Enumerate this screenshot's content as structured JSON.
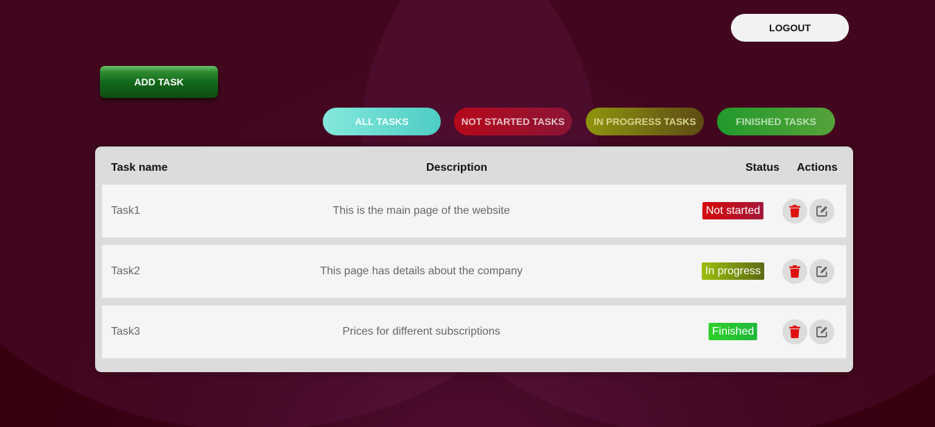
{
  "header": {
    "logout_label": "LOGOUT",
    "add_task_label": "ADD TASK"
  },
  "filters": [
    {
      "label": "ALL TASKS",
      "active": true
    },
    {
      "label": "NOT STARTED TASKS",
      "active": false
    },
    {
      "label": "IN PROGRESS TASKS",
      "active": false
    },
    {
      "label": "FINISHED TASKS",
      "active": false
    }
  ],
  "table": {
    "columns": [
      "Task name",
      "Description",
      "Status",
      "Actions"
    ],
    "rows": [
      {
        "name": "Task1",
        "description": "This is the main page of the website",
        "status": "Not started"
      },
      {
        "name": "Task2",
        "description": "This page has details about the company",
        "status": "In progress"
      },
      {
        "name": "Task3",
        "description": "Prices for different subscriptions",
        "status": "Finished"
      }
    ]
  },
  "icons": {
    "delete": "trash-icon",
    "edit": "edit-icon"
  },
  "colors": {
    "background": "#36000f",
    "delete_icon": "#e01010",
    "edit_icon": "#666666",
    "status_not_started": "#d60a0a",
    "status_in_progress": "#9cbe0c",
    "status_finished": "#2ed02a"
  }
}
